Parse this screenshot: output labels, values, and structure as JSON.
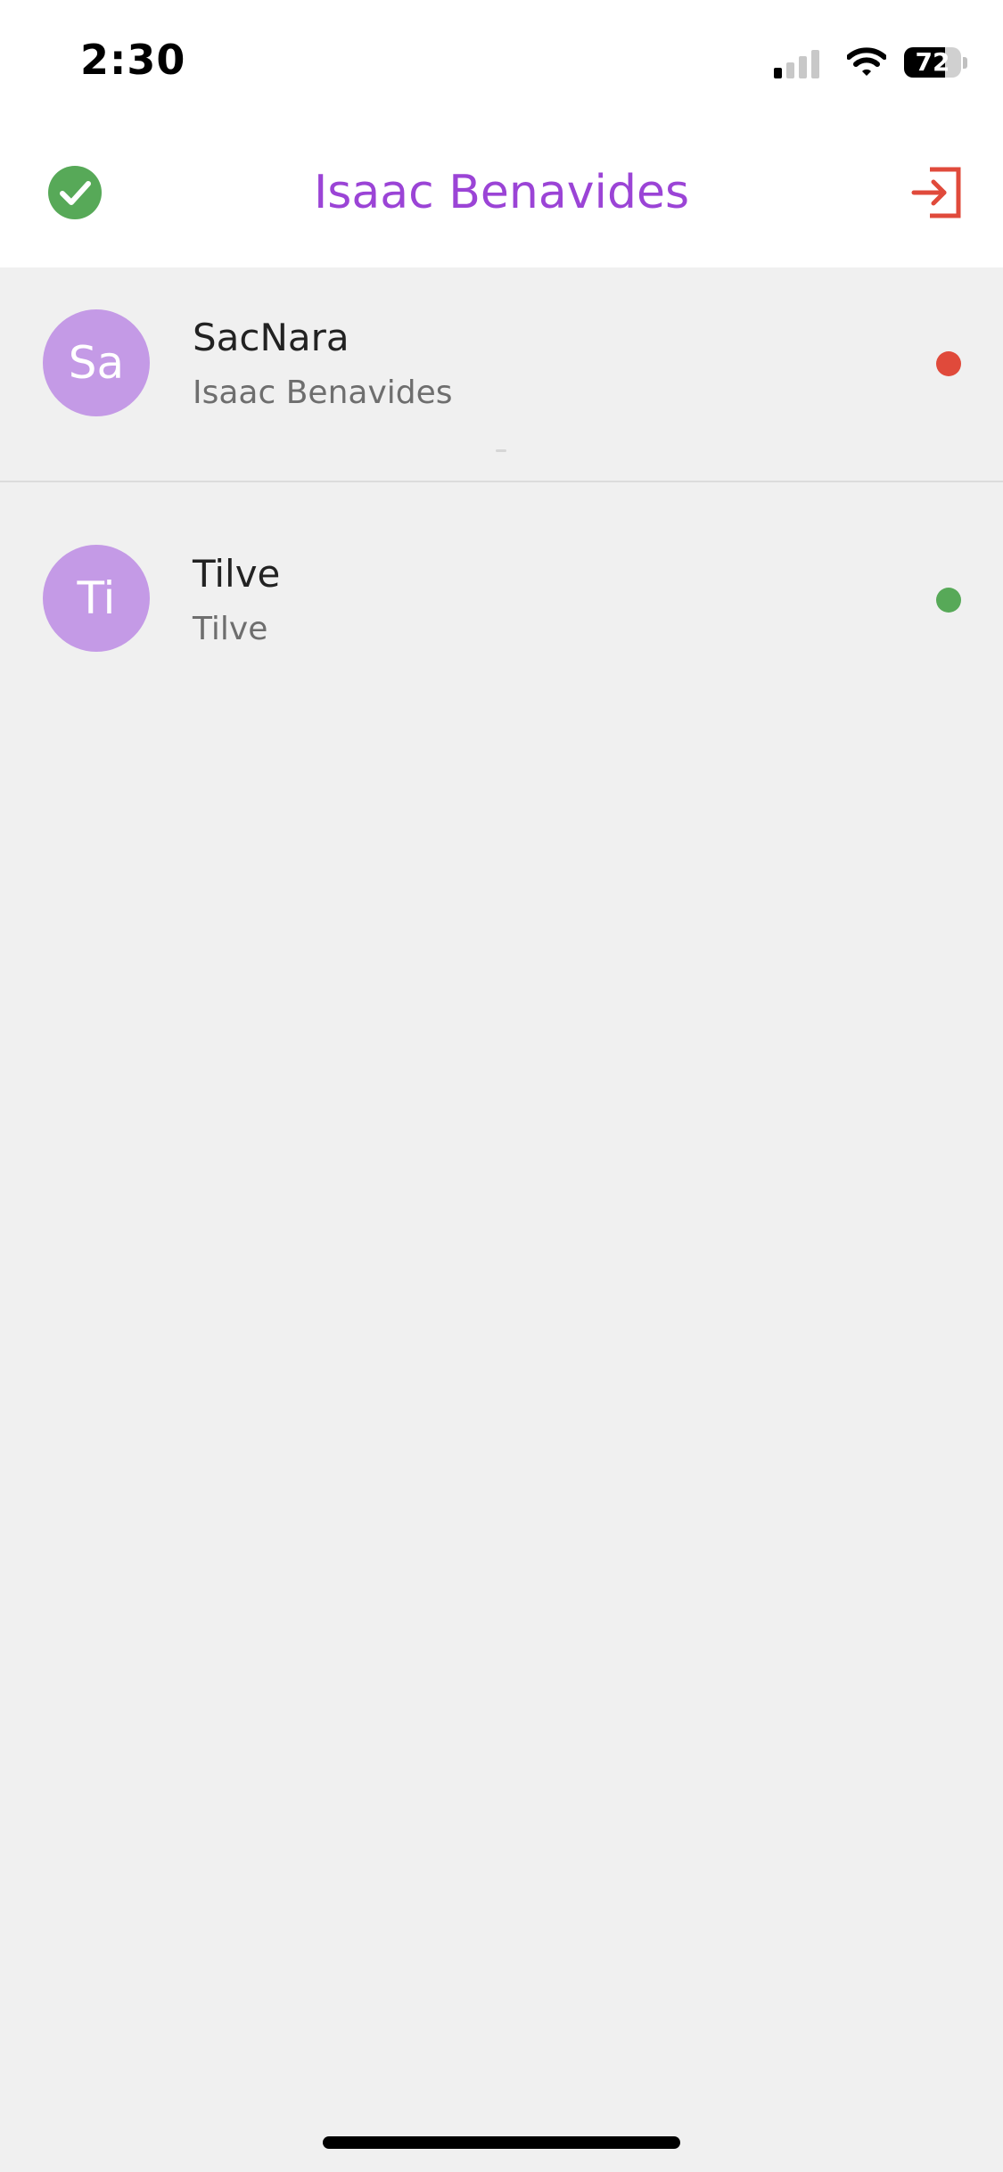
{
  "status_bar": {
    "time": "2:30",
    "battery_level": 72,
    "battery_text": "72",
    "signal_bars_active": 1,
    "signal_bars_total": 4,
    "icons": [
      "cellular-signal-icon",
      "wifi-icon",
      "battery-icon"
    ]
  },
  "header": {
    "title": "Isaac Benavides",
    "left_icon": "check-circle-icon",
    "right_icon": "logout-icon"
  },
  "colors": {
    "accent": "#9b44d6",
    "avatar_bg": "#c49ae6",
    "online": "#57a958",
    "offline": "#e04a3b",
    "logout": "#e04a3b",
    "check": "#57a958"
  },
  "contacts": [
    {
      "initials": "Sa",
      "name": "SacNara",
      "subtitle": "Isaac Benavides",
      "status": "offline"
    },
    {
      "initials": "Ti",
      "name": "Tilve",
      "subtitle": "Tilve",
      "status": "online"
    }
  ]
}
